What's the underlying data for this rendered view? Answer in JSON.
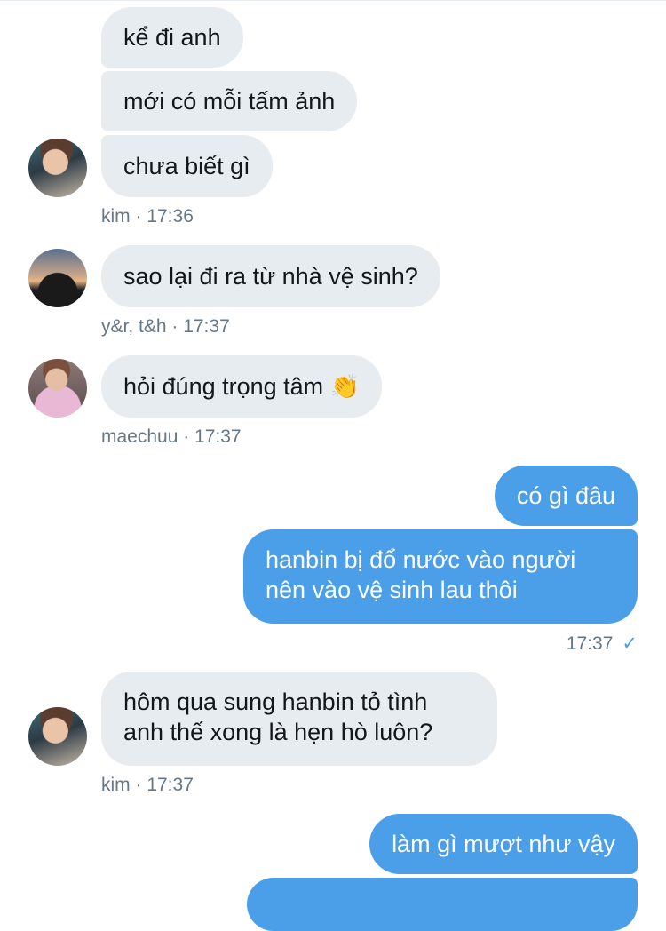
{
  "messages": [
    {
      "text": "kể đi anh"
    },
    {
      "text": "mới có mỗi tấm ảnh"
    },
    {
      "text": "chưa biết gì"
    },
    {
      "text": "sao lại đi ra từ nhà vệ sinh?"
    },
    {
      "text": "hỏi đúng trọng tâm 👏"
    },
    {
      "text": "có gì đâu"
    },
    {
      "line1": "hanbin bị đổ nước vào người",
      "line2": "nên vào vệ sinh lau thôi"
    },
    {
      "line1": "hôm qua sung hanbin tỏ tình",
      "line2": "anh thế xong là hẹn hò luôn?"
    },
    {
      "text": "làm gì mượt như vậy"
    }
  ],
  "meta": {
    "kim_1": "kim · 17:36",
    "yr": "y&r, t&h · 17:37",
    "mae": "maechuu · 17:37",
    "sent_time": "17:37",
    "sent_check": "✓",
    "kim_2": "kim · 17:37"
  },
  "colors": {
    "incoming_bubble": "#e6ecf0",
    "outgoing_bubble": "#4a9fe8",
    "meta_text": "#657786"
  },
  "icons": [
    "avatar-kim",
    "avatar-yr-th",
    "avatar-maechuu",
    "read-check-icon"
  ]
}
